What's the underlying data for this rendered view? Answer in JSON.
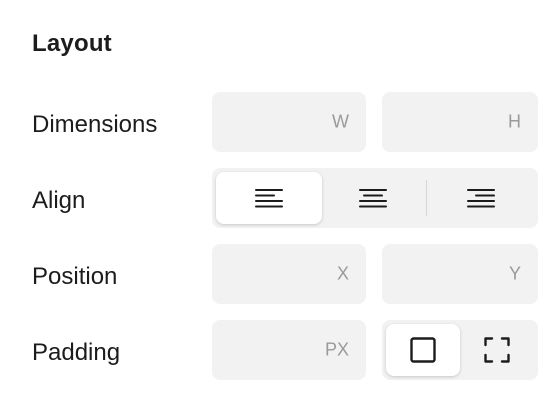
{
  "panel": {
    "title": "Layout"
  },
  "rows": {
    "dimensions": {
      "label": "Dimensions",
      "width_unit": "W",
      "height_unit": "H",
      "width_value": "",
      "height_value": ""
    },
    "align": {
      "label": "Align",
      "options": [
        "left",
        "center",
        "right"
      ],
      "selected": "left"
    },
    "position": {
      "label": "Position",
      "x_unit": "X",
      "y_unit": "Y",
      "x_value": "",
      "y_value": ""
    },
    "padding": {
      "label": "Padding",
      "unit": "PX",
      "value": "",
      "modes": [
        "uniform",
        "individual"
      ],
      "selected_mode": "uniform"
    }
  },
  "colors": {
    "field_bg": "#f2f2f2",
    "active_bg": "#ffffff",
    "text": "#1c1c1c",
    "unit_text": "#9a9a9a"
  }
}
